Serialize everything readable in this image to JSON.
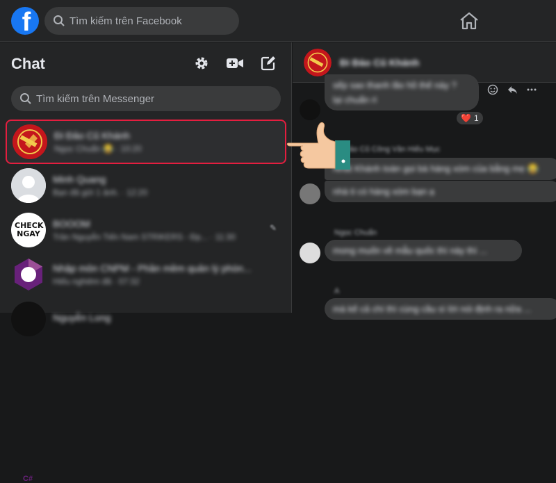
{
  "topbar": {
    "logo_letter": "f",
    "search_placeholder": "Tìm kiếm trên Facebook"
  },
  "sidebar": {
    "title": "Chat",
    "search_placeholder": "Tìm kiếm trên Messenger",
    "conversations": [
      {
        "name": "Đi Đảo Cũ Khánh",
        "sub": "Ngọc Chuẩn 😂 · 10:20"
      },
      {
        "name": "Minh Quang",
        "sub": "Bạn đã gửi 1 ảnh. · 12:20"
      },
      {
        "name": "BOOOM",
        "sub": "Trần Nguyễn Tiến Nam STRIKERS - Đp... · 11:30"
      },
      {
        "name": "Nhập môn CNPM - Phần mềm quản lý phòn...",
        "sub": "Hiếu nghiêm đã · 07:32"
      },
      {
        "name": "Nguyễn Long",
        "sub": ""
      }
    ],
    "checknay_text": "CHECK NGAY",
    "csharp_text": "C#"
  },
  "chat": {
    "header_name": "Đi Đảo Cũ Khánh",
    "messages": [
      {
        "text": "sếp sao thanh lão hồ thế này ?"
      },
      {
        "text": "lại chuẩn rì"
      },
      {
        "text": "Nhất Khánh toàn gọi bà hàng xóm của bằng mẹ 😂"
      },
      {
        "text": "nhà ti có hàng xóm bạn ạ"
      },
      {
        "text": "mong muốn về mẫu quốc thì này thì ..."
      },
      {
        "text": "mà kế cả chí thì cùng cầu sì lời nói định ra nữa ..."
      }
    ],
    "labels": [
      "Đi Đảo Cũ Công Văn Hiếu Mục",
      "Ngọc Chuẩn",
      "A"
    ],
    "reaction": {
      "emoji": "❤️",
      "count": "1"
    }
  },
  "colors": {
    "accent": "#1877f2",
    "highlight_border": "#e41e3f"
  }
}
